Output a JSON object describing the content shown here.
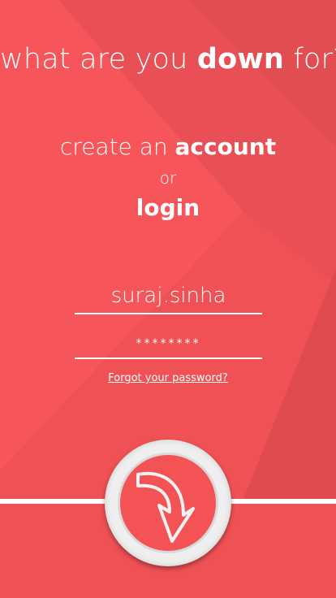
{
  "header": {
    "prefix": "what are you ",
    "emphasis": "down",
    "suffix": " for?"
  },
  "auth": {
    "create_prefix": "create an ",
    "create_emphasis": "account",
    "or_text": "or",
    "login_label": "login"
  },
  "form": {
    "username_value": "suraj.sinha",
    "password_value": "********"
  },
  "links": {
    "forgot_password": "Forgot your password?"
  },
  "submit": {
    "icon": "curved-arrow-down-icon"
  },
  "colors": {
    "background": "#f45356",
    "foreground": "#ffffff",
    "button_ring": "#efefef"
  }
}
